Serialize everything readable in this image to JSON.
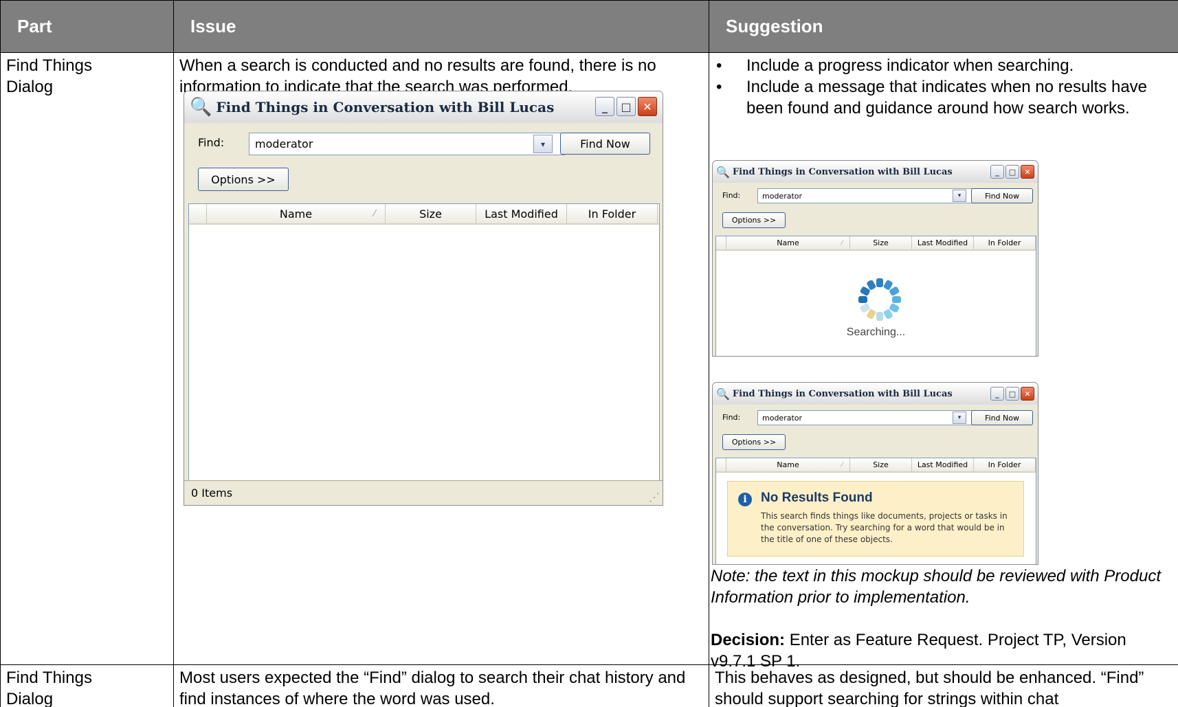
{
  "table": {
    "headers": [
      "Part",
      "Issue",
      "Suggestion"
    ],
    "row1": {
      "part": "Find Things Dialog",
      "issue": "When a search is conducted and no results are found, there is no information to indicate that the search was performed.",
      "suggestions": [
        "Include a progress indicator when searching.",
        "Include a message that indicates when no results have been found and guidance around how search works."
      ],
      "note": "Note: the text in this mockup should be reviewed with Product Information prior to implementation.",
      "decision_label": "Decision:",
      "decision_text": " Enter as Feature Request. Project TP, Version v9.7.1 SP 1."
    },
    "row2": {
      "part": "Find Things Dialog",
      "issue": "Most users expected the “Find” dialog to search their chat history and find instances of where the word was used.",
      "suggestion": "This behaves as designed, but should be enhanced. “Find” should support searching for strings within chat"
    }
  },
  "dialog": {
    "title": "Find Things in Conversation with Bill Lucas",
    "find_label": "Find:",
    "find_value": "moderator",
    "find_now": "Find Now",
    "options": "Options >>",
    "columns": [
      "Name",
      "Size",
      "Last Modified",
      "In Folder"
    ],
    "status": "0 Items",
    "minimize": "_",
    "maximize": "□",
    "close": "✕",
    "dropdown": "▾",
    "sort_glyph": "⁄",
    "search_icon": "magnifier-icon"
  },
  "searching": {
    "text": "Searching..."
  },
  "no_results": {
    "title": "No Results Found",
    "body": "This search finds things like documents, projects or tasks in the conversation. Try searching for a word that would be in the title of one of these objects."
  },
  "colors": {
    "header_bg": "#7f7f7f",
    "dialog_bg": "#ece9d8",
    "notice_bg": "#fdf0c8",
    "info_blue": "#1f5fa8"
  }
}
